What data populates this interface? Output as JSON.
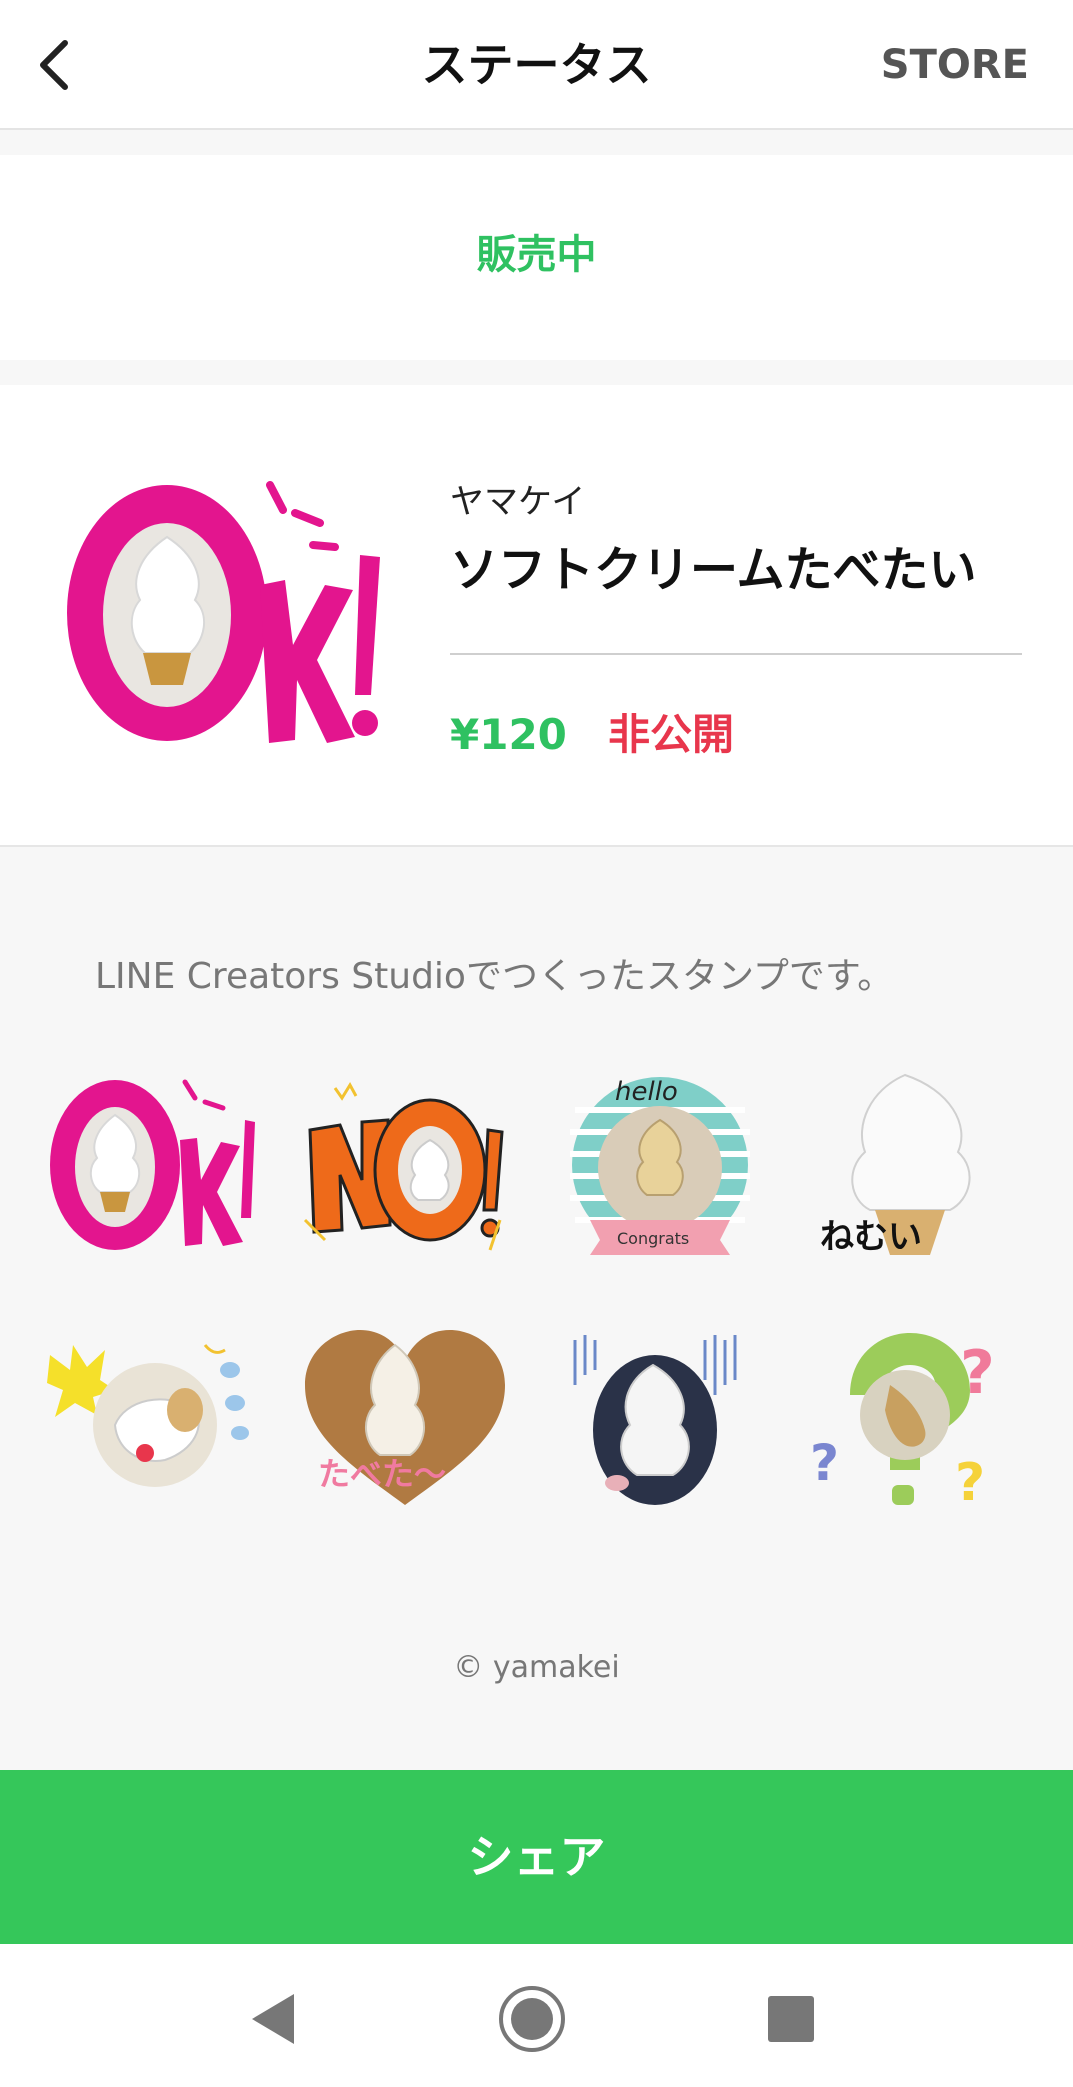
{
  "header": {
    "title": "ステータス",
    "store_label": "STORE",
    "back_icon": "chevron-left-icon"
  },
  "status": {
    "label": "販売中",
    "color": "#2fc161"
  },
  "product": {
    "author": "ヤマケイ",
    "title": "ソフトクリームたべたい",
    "price": "¥120",
    "visibility": "非公開",
    "price_color": "#2fc161",
    "visibility_color": "#e8364c"
  },
  "note": "LINE Creators Studioでつくったスタンプです。",
  "stickers": [
    {
      "name": "ok",
      "caption": "Ok!"
    },
    {
      "name": "no",
      "caption": "NO!"
    },
    {
      "name": "hello-congrats",
      "caption": "hello",
      "sub_caption": "Congrats"
    },
    {
      "name": "sleepy",
      "caption": "ねむい"
    },
    {
      "name": "surprise",
      "caption": ""
    },
    {
      "name": "heart-eat",
      "caption": "たべたい〜"
    },
    {
      "name": "shock",
      "caption": ""
    },
    {
      "name": "question",
      "caption": "?"
    }
  ],
  "copyright": "© yamakei",
  "share_label": "シェア",
  "share_color": "#35c75a",
  "nav": {
    "back_icon": "nav-back-icon",
    "home_icon": "nav-home-icon",
    "recents_icon": "nav-recents-icon"
  }
}
